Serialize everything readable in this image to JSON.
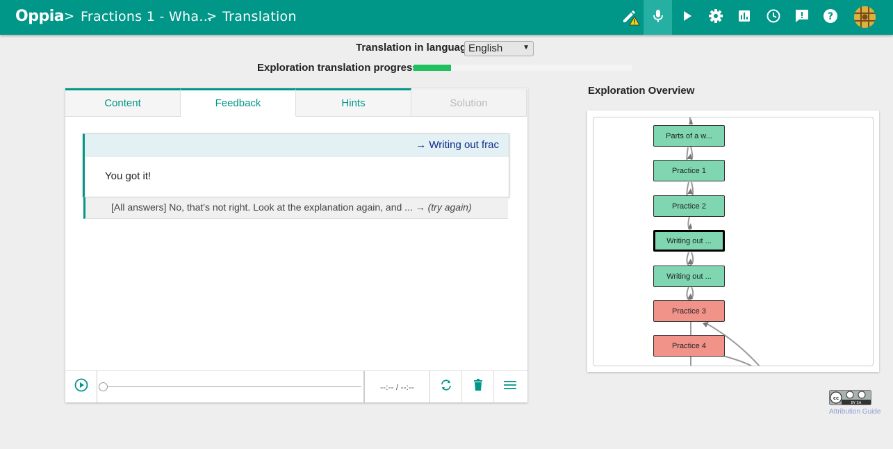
{
  "nav": {
    "logo": "Oppia",
    "crumbs": [
      "Fractions 1 - Wha...",
      "Translation"
    ],
    "separator": ">",
    "icons": [
      "pencil-warning-icon",
      "microphone-icon",
      "play-icon",
      "gear-icon",
      "bar-chart-icon",
      "history-clock-icon",
      "feedback-icon",
      "help-icon"
    ]
  },
  "translation": {
    "language_label": "Translation in language:",
    "language_value": "English",
    "progress_label": "Exploration translation progress:",
    "progress_fraction": 0.17
  },
  "tabs": [
    {
      "label": "Content",
      "state": "normal"
    },
    {
      "label": "Feedback",
      "state": "active"
    },
    {
      "label": "Hints",
      "state": "normal"
    },
    {
      "label": "Solution",
      "state": "disabled"
    }
  ],
  "feedback": {
    "header": "→ Writing out frac",
    "body": "You got it!",
    "row2_text": "[All answers] No, that's not right. Look at the explanation again, and ... →",
    "row2_try": "(try again)"
  },
  "audio": {
    "time": "--:-- / --:--"
  },
  "overview": {
    "title": "Exploration Overview",
    "nodes": [
      {
        "label": "Parts of a w...",
        "color": "green"
      },
      {
        "label": "Practice 1",
        "color": "green"
      },
      {
        "label": "Practice 2",
        "color": "green"
      },
      {
        "label": "Writing out ...",
        "color": "green",
        "current": true
      },
      {
        "label": "Writing out ...",
        "color": "green"
      },
      {
        "label": "Practice 3",
        "color": "red"
      },
      {
        "label": "Practice 4",
        "color": "red"
      }
    ]
  },
  "footer": {
    "attribution": "Attribution Guide",
    "cc_text": "BY SA"
  },
  "colors": {
    "primary": "#009688",
    "progress": "#1ec15d",
    "node_green": "#7fd6b1",
    "node_red": "#f2938a"
  }
}
